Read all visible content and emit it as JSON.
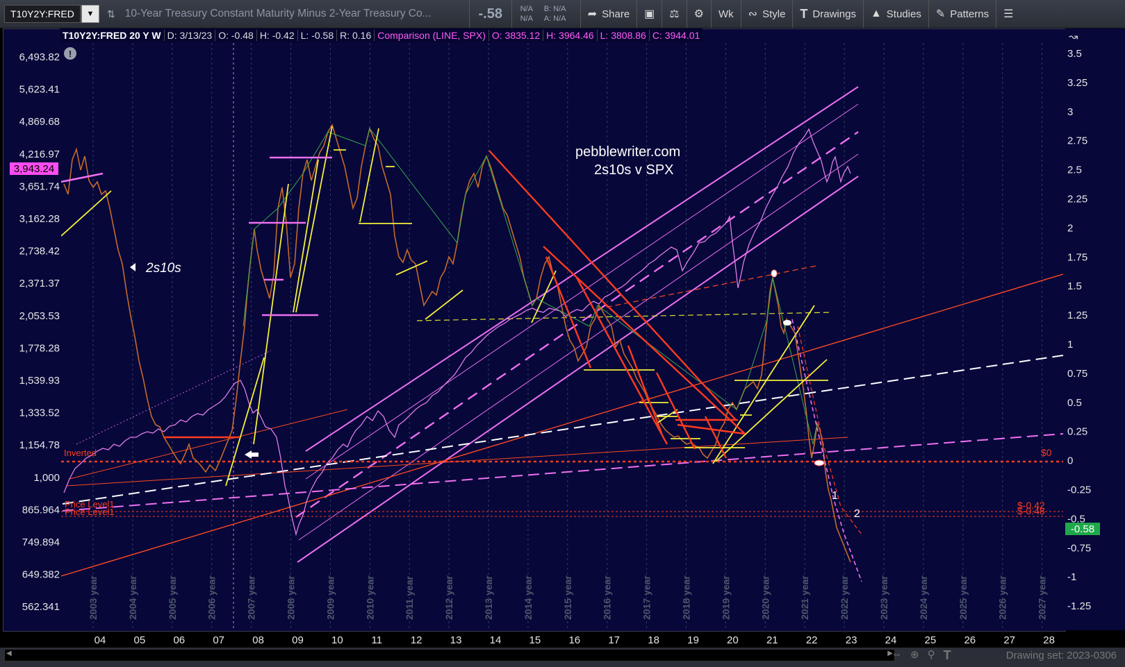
{
  "toolbar": {
    "symbol": "T10Y2Y:FRED",
    "description": "10-Year Treasury Constant Maturity Minus 2-Year Treasury Co...",
    "last": "-.58",
    "na1": "N/A",
    "na2": "N/A",
    "bid": "B: N/A",
    "ask": "A: N/A",
    "share": "Share",
    "interval": "Wk",
    "style": "Style",
    "drawings": "Drawings",
    "studies": "Studies",
    "patterns": "Patterns"
  },
  "header": {
    "symbol": "T10Y2Y:FRED 20 Y W",
    "date": "D: 3/13/23",
    "open": "O: -0.48",
    "high": "H: -0.42",
    "low": "L: -0.58",
    "range": "R: 0.16",
    "comparison": "Comparison (LINE, SPX)",
    "c_open": "O: 3835.12",
    "c_high": "H: 3964.46",
    "c_low": "L: 3808.86",
    "c_close": "C: 3944.01"
  },
  "left_axis": [
    "6,493.82",
    "5,623.41",
    "4,869.68",
    "4,216.97",
    "3,651.74",
    "3,162.28",
    "2,738.42",
    "2,371.37",
    "2,053.53",
    "1,778.28",
    "1,539.93",
    "1,333.52",
    "1,154.78",
    "1,000",
    "865.964",
    "749.894",
    "649.382",
    "562.341"
  ],
  "left_price_badge": "3,943.24",
  "right_axis": [
    "3.5",
    "3.25",
    "3",
    "2.75",
    "2.5",
    "2.25",
    "2",
    "1.75",
    "1.5",
    "1.25",
    "1",
    "0.75",
    "0.5",
    "0.25",
    "0",
    "-0.25",
    "-0.5",
    "-0.75",
    "-1",
    "-1.25"
  ],
  "right_price_badge": "-0.58",
  "x_axis": [
    "04",
    "05",
    "06",
    "07",
    "08",
    "09",
    "10",
    "11",
    "12",
    "13",
    "14",
    "15",
    "16",
    "17",
    "18",
    "19",
    "20",
    "21",
    "22",
    "23",
    "24",
    "25",
    "26",
    "27",
    "28"
  ],
  "year_labels": [
    "2003 year",
    "2004 year",
    "2005 year",
    "2006 year",
    "2007 year",
    "2008 year",
    "2009 year",
    "2010 year",
    "2011 year",
    "2012 year",
    "2013 year",
    "2014 year",
    "2015 year",
    "2016 year",
    "2017 year",
    "2018 year",
    "2019 year",
    "2020 year",
    "2021 year",
    "2022 year",
    "2023 year",
    "2024 year",
    "2025 year",
    "2026 year",
    "2027 year"
  ],
  "annotations": {
    "site": "pebblewriter.com",
    "subtitle": "2s10s v SPX",
    "series_label": "2s10s",
    "inverted": "Inverted",
    "price_level_1": "Price Level1",
    "price_level_2": "Price Level1",
    "zero_label": "$0",
    "lvl_a": "$-0.42",
    "lvl_b": "$-0.48",
    "wave1": "1",
    "wave2": "2"
  },
  "footer": {
    "drawing_set": "Drawing set: 2023-0306"
  },
  "colors": {
    "background": "#07073a",
    "spx": "#e07de8",
    "channel": "#ee6ff0",
    "trend_red": "#ff3b1f",
    "yellow": "#f4f03a",
    "badge_green": "#1fa84a",
    "badge_magenta": "#ff4df2"
  }
}
